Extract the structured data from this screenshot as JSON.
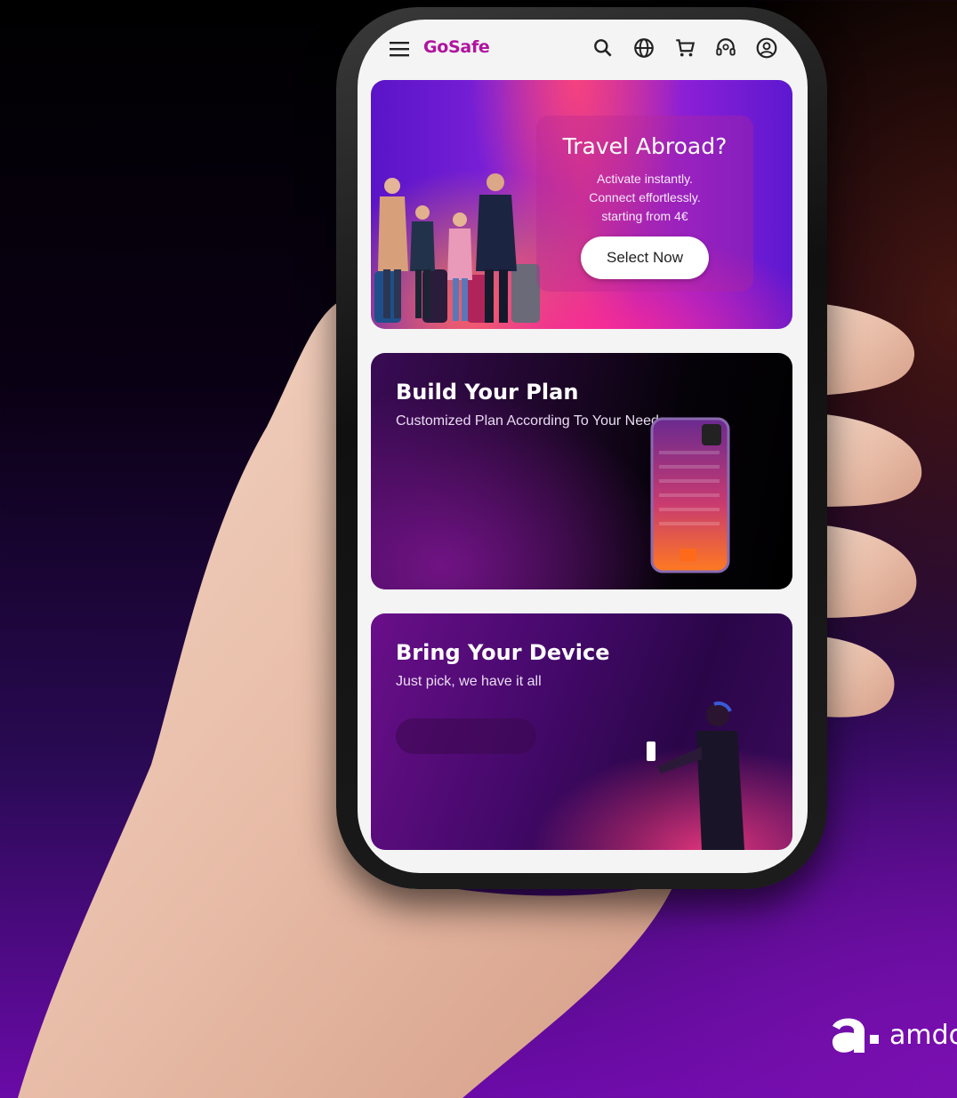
{
  "app": {
    "brand": "GoSafe"
  },
  "topbar": {
    "icons": [
      "menu-icon",
      "search-icon",
      "globe-icon",
      "cart-icon",
      "support-icon",
      "account-icon"
    ]
  },
  "travel_card": {
    "title": "Travel Abroad?",
    "line1": "Activate instantly.",
    "line2": "Connect effortlessly.",
    "line3": "starting from 4€",
    "button": "Select Now"
  },
  "plan_card": {
    "title": "Build Your Plan",
    "subtitle": "Customized Plan According To Your Needs"
  },
  "device_card": {
    "title": "Bring Your Device",
    "subtitle": "Just pick, we have it all"
  },
  "footer": {
    "logo_text": "amdo"
  },
  "colors": {
    "brand": "#b0149e",
    "accent": "#7a0fb0"
  }
}
